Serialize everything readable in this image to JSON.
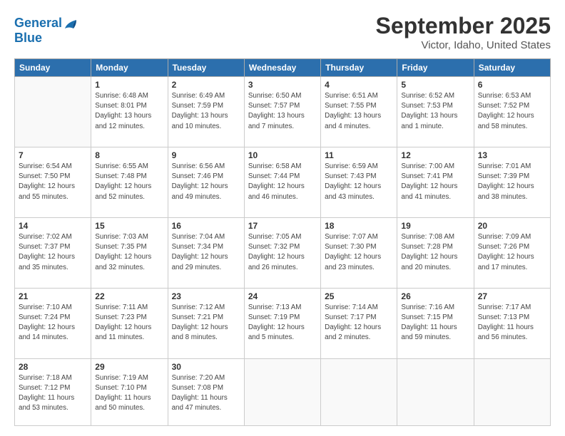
{
  "logo": {
    "line1": "General",
    "line2": "Blue"
  },
  "title": "September 2025",
  "location": "Victor, Idaho, United States",
  "headers": [
    "Sunday",
    "Monday",
    "Tuesday",
    "Wednesday",
    "Thursday",
    "Friday",
    "Saturday"
  ],
  "weeks": [
    [
      {
        "num": "",
        "info": ""
      },
      {
        "num": "1",
        "info": "Sunrise: 6:48 AM\nSunset: 8:01 PM\nDaylight: 13 hours\nand 12 minutes."
      },
      {
        "num": "2",
        "info": "Sunrise: 6:49 AM\nSunset: 7:59 PM\nDaylight: 13 hours\nand 10 minutes."
      },
      {
        "num": "3",
        "info": "Sunrise: 6:50 AM\nSunset: 7:57 PM\nDaylight: 13 hours\nand 7 minutes."
      },
      {
        "num": "4",
        "info": "Sunrise: 6:51 AM\nSunset: 7:55 PM\nDaylight: 13 hours\nand 4 minutes."
      },
      {
        "num": "5",
        "info": "Sunrise: 6:52 AM\nSunset: 7:53 PM\nDaylight: 13 hours\nand 1 minute."
      },
      {
        "num": "6",
        "info": "Sunrise: 6:53 AM\nSunset: 7:52 PM\nDaylight: 12 hours\nand 58 minutes."
      }
    ],
    [
      {
        "num": "7",
        "info": "Sunrise: 6:54 AM\nSunset: 7:50 PM\nDaylight: 12 hours\nand 55 minutes."
      },
      {
        "num": "8",
        "info": "Sunrise: 6:55 AM\nSunset: 7:48 PM\nDaylight: 12 hours\nand 52 minutes."
      },
      {
        "num": "9",
        "info": "Sunrise: 6:56 AM\nSunset: 7:46 PM\nDaylight: 12 hours\nand 49 minutes."
      },
      {
        "num": "10",
        "info": "Sunrise: 6:58 AM\nSunset: 7:44 PM\nDaylight: 12 hours\nand 46 minutes."
      },
      {
        "num": "11",
        "info": "Sunrise: 6:59 AM\nSunset: 7:43 PM\nDaylight: 12 hours\nand 43 minutes."
      },
      {
        "num": "12",
        "info": "Sunrise: 7:00 AM\nSunset: 7:41 PM\nDaylight: 12 hours\nand 41 minutes."
      },
      {
        "num": "13",
        "info": "Sunrise: 7:01 AM\nSunset: 7:39 PM\nDaylight: 12 hours\nand 38 minutes."
      }
    ],
    [
      {
        "num": "14",
        "info": "Sunrise: 7:02 AM\nSunset: 7:37 PM\nDaylight: 12 hours\nand 35 minutes."
      },
      {
        "num": "15",
        "info": "Sunrise: 7:03 AM\nSunset: 7:35 PM\nDaylight: 12 hours\nand 32 minutes."
      },
      {
        "num": "16",
        "info": "Sunrise: 7:04 AM\nSunset: 7:34 PM\nDaylight: 12 hours\nand 29 minutes."
      },
      {
        "num": "17",
        "info": "Sunrise: 7:05 AM\nSunset: 7:32 PM\nDaylight: 12 hours\nand 26 minutes."
      },
      {
        "num": "18",
        "info": "Sunrise: 7:07 AM\nSunset: 7:30 PM\nDaylight: 12 hours\nand 23 minutes."
      },
      {
        "num": "19",
        "info": "Sunrise: 7:08 AM\nSunset: 7:28 PM\nDaylight: 12 hours\nand 20 minutes."
      },
      {
        "num": "20",
        "info": "Sunrise: 7:09 AM\nSunset: 7:26 PM\nDaylight: 12 hours\nand 17 minutes."
      }
    ],
    [
      {
        "num": "21",
        "info": "Sunrise: 7:10 AM\nSunset: 7:24 PM\nDaylight: 12 hours\nand 14 minutes."
      },
      {
        "num": "22",
        "info": "Sunrise: 7:11 AM\nSunset: 7:23 PM\nDaylight: 12 hours\nand 11 minutes."
      },
      {
        "num": "23",
        "info": "Sunrise: 7:12 AM\nSunset: 7:21 PM\nDaylight: 12 hours\nand 8 minutes."
      },
      {
        "num": "24",
        "info": "Sunrise: 7:13 AM\nSunset: 7:19 PM\nDaylight: 12 hours\nand 5 minutes."
      },
      {
        "num": "25",
        "info": "Sunrise: 7:14 AM\nSunset: 7:17 PM\nDaylight: 12 hours\nand 2 minutes."
      },
      {
        "num": "26",
        "info": "Sunrise: 7:16 AM\nSunset: 7:15 PM\nDaylight: 11 hours\nand 59 minutes."
      },
      {
        "num": "27",
        "info": "Sunrise: 7:17 AM\nSunset: 7:13 PM\nDaylight: 11 hours\nand 56 minutes."
      }
    ],
    [
      {
        "num": "28",
        "info": "Sunrise: 7:18 AM\nSunset: 7:12 PM\nDaylight: 11 hours\nand 53 minutes."
      },
      {
        "num": "29",
        "info": "Sunrise: 7:19 AM\nSunset: 7:10 PM\nDaylight: 11 hours\nand 50 minutes."
      },
      {
        "num": "30",
        "info": "Sunrise: 7:20 AM\nSunset: 7:08 PM\nDaylight: 11 hours\nand 47 minutes."
      },
      {
        "num": "",
        "info": ""
      },
      {
        "num": "",
        "info": ""
      },
      {
        "num": "",
        "info": ""
      },
      {
        "num": "",
        "info": ""
      }
    ]
  ]
}
